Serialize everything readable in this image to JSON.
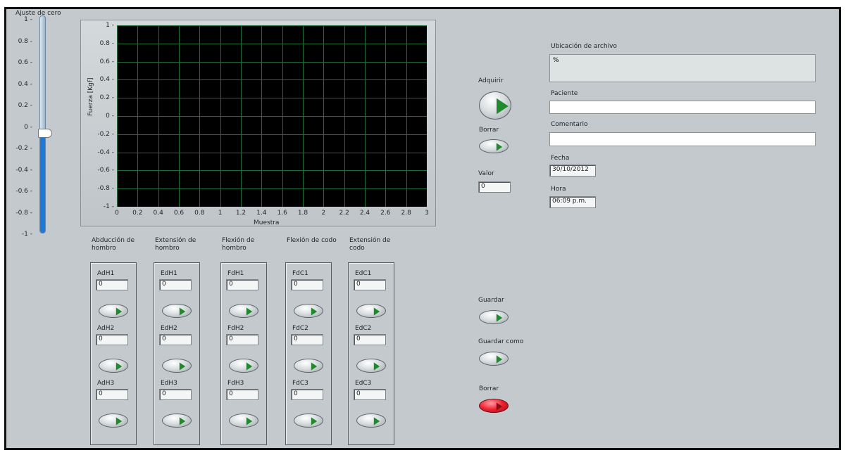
{
  "slider": {
    "label": "Ajuste de cero",
    "ticks": [
      "1",
      "0.8",
      "0.6",
      "0.4",
      "0.2",
      "0",
      "-0.2",
      "-0.4",
      "-0.6",
      "-0.8",
      "-1"
    ],
    "value": 0
  },
  "graph": {
    "ylabel": "Fuerza [Kgf]",
    "xlabel": "Muestra",
    "yticks": [
      "1",
      "0.8",
      "0.6",
      "0.4",
      "0.2",
      "0",
      "-0.2",
      "-0.4",
      "-0.6",
      "-0.8",
      "-1"
    ],
    "xticks": [
      "0",
      "0.2",
      "0.4",
      "0.6",
      "0.8",
      "1",
      "1.2",
      "1.4",
      "1.6",
      "1.8",
      "2",
      "2.2",
      "2.4",
      "2.6",
      "2.8",
      "3"
    ],
    "xlim": [
      0,
      3
    ],
    "ylim": [
      -1,
      1
    ],
    "grid": true,
    "background": "#000000",
    "grid_color": "#1f6b3a"
  },
  "controls": {
    "adquirir_label": "Adquirir",
    "borrar_label": "Borrar",
    "valor_label": "Valor",
    "valor_value": "0",
    "guardar_label": "Guardar",
    "guardar_como_label": "Guardar como",
    "borrar2_label": "Borrar"
  },
  "file": {
    "ubicacion_label": "Ubicación de archivo",
    "ubicacion_value": "%",
    "paciente_label": "Paciente",
    "paciente_value": "",
    "comentario_label": "Comentario",
    "comentario_value": "",
    "fecha_label": "Fecha",
    "fecha_value": "30/10/2012",
    "hora_label": "Hora",
    "hora_value": "06:09 p.m."
  },
  "groups": [
    {
      "title": "Abducción de hombro",
      "items": [
        {
          "name": "AdH1",
          "value": "0"
        },
        {
          "name": "AdH2",
          "value": "0"
        },
        {
          "name": "AdH3",
          "value": "0"
        }
      ]
    },
    {
      "title": "Extensión de hombro",
      "items": [
        {
          "name": "EdH1",
          "value": "0"
        },
        {
          "name": "EdH2",
          "value": "0"
        },
        {
          "name": "EdH3",
          "value": "0"
        }
      ]
    },
    {
      "title": "Flexión de hombro",
      "items": [
        {
          "name": "FdH1",
          "value": "0"
        },
        {
          "name": "FdH2",
          "value": "0"
        },
        {
          "name": "FdH3",
          "value": "0"
        }
      ]
    },
    {
      "title": "Flexión de codo",
      "items": [
        {
          "name": "FdC1",
          "value": "0"
        },
        {
          "name": "FdC2",
          "value": "0"
        },
        {
          "name": "FdC3",
          "value": "0"
        }
      ]
    },
    {
      "title": "Extensión de codo",
      "items": [
        {
          "name": "EdC1",
          "value": "0"
        },
        {
          "name": "EdC2",
          "value": "0"
        },
        {
          "name": "EdC3",
          "value": "0"
        }
      ]
    }
  ],
  "colors": {
    "panel": "#c3c9cc",
    "led_green": "#1f8a2c",
    "stop_red": "#f02030"
  }
}
